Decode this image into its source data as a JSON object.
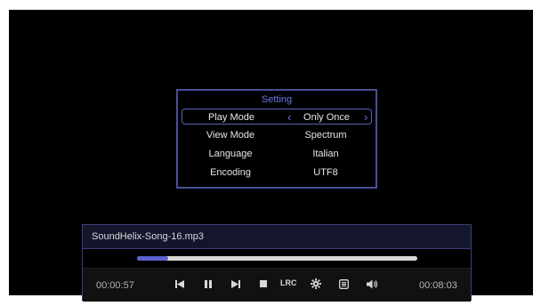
{
  "setting": {
    "title": "Setting",
    "rows": [
      {
        "label": "Play Mode",
        "value": "Only Once",
        "selected": true
      },
      {
        "label": "View Mode",
        "value": "Spectrum"
      },
      {
        "label": "Language",
        "value": "Italian"
      },
      {
        "label": "Encoding",
        "value": "UTF8"
      }
    ],
    "left_arrow": "‹",
    "right_arrow": "›"
  },
  "player": {
    "filename": "SoundHelix-Song-16.mp3",
    "elapsed": "00:00:57",
    "total": "00:08:03",
    "progress_fraction": 0.11,
    "lrc_label": "LRC",
    "icons": [
      "prev-track-icon",
      "pause-icon",
      "next-track-icon",
      "stop-icon",
      "lrc-label",
      "settings-gear-icon",
      "playlist-icon",
      "volume-icon"
    ]
  },
  "colors": {
    "accent": "#6b74e6",
    "progress_fill": "#5a62d0",
    "frame": "#4a4f96"
  }
}
